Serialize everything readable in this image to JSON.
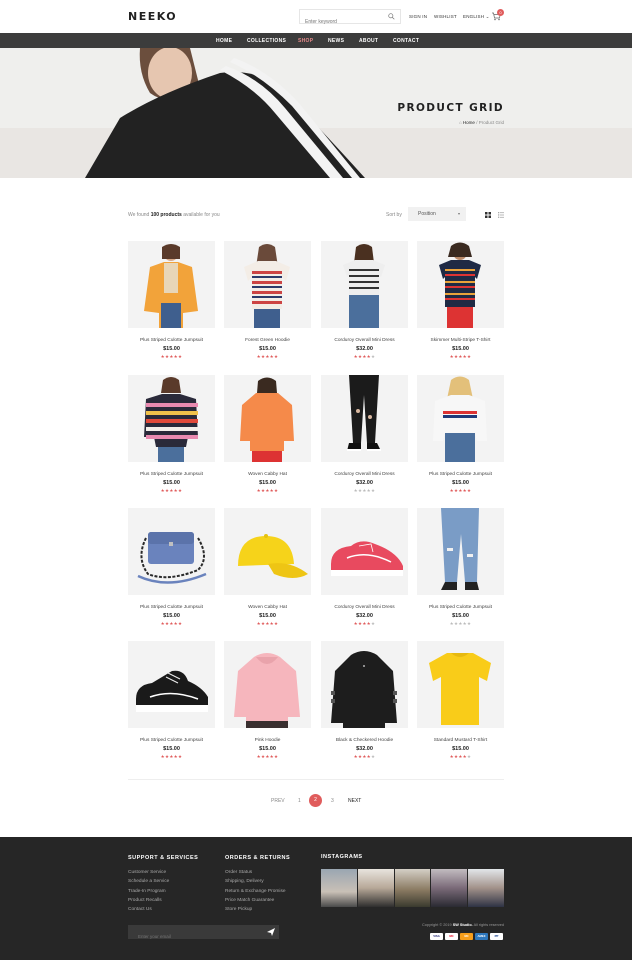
{
  "header": {
    "logo": "NEEKO",
    "search_placeholder": "Enter keyword",
    "sign_in": "SIGN IN",
    "wishlist": "WISHLIST",
    "language": "ENGLISH",
    "cart_count": "0"
  },
  "nav": {
    "items": [
      {
        "label": "HOME"
      },
      {
        "label": "COLLECTIONS"
      },
      {
        "label": "SHOP",
        "active": true
      },
      {
        "label": "NEWS"
      },
      {
        "label": "ABOUT"
      },
      {
        "label": "CONTACT"
      }
    ]
  },
  "hero": {
    "title": "PRODUCT GRID",
    "breadcrumb_home": "Home",
    "breadcrumb_sep": "/",
    "breadcrumb_current": "Product Grid"
  },
  "toolbar": {
    "found_prefix": "We found",
    "found_count": "100 products",
    "found_suffix": "available for you",
    "sort_label": "Sort by",
    "sort_value": "Position"
  },
  "products": [
    {
      "name": "Plus Striped Culotte Jumpsuit",
      "price": "$15.00",
      "rating": 5
    },
    {
      "name": "Forest Green Hoodie",
      "price": "$15.00",
      "rating": 5
    },
    {
      "name": "Corduroy Overall Mini Dress",
      "price": "$32.00",
      "rating": 4
    },
    {
      "name": "Skimmer Multi-Stripe T-Shirt",
      "price": "$15.00",
      "rating": 5
    },
    {
      "name": "Plus Striped Culotte Jumpsuit",
      "price": "$15.00",
      "rating": 5
    },
    {
      "name": "Woven Cabby Hat",
      "price": "$15.00",
      "rating": 5
    },
    {
      "name": "Corduroy Overall Mini Dress",
      "price": "$32.00",
      "rating": 0
    },
    {
      "name": "Plus Striped Culotte Jumpsuit",
      "price": "$15.00",
      "rating": 5
    },
    {
      "name": "Plus Striped Culotte Jumpsuit",
      "price": "$15.00",
      "rating": 5
    },
    {
      "name": "Woven Cabby Hat",
      "price": "$15.00",
      "rating": 5
    },
    {
      "name": "Corduroy Overall Mini Dress",
      "price": "$32.00",
      "rating": 4
    },
    {
      "name": "Plus Striped Culotte Jumpsuit",
      "price": "$15.00",
      "rating": 0
    },
    {
      "name": "Plus Striped Culotte Jumpsuit",
      "price": "$15.00",
      "rating": 5
    },
    {
      "name": "Pink Hoodie",
      "price": "$15.00",
      "rating": 5
    },
    {
      "name": "Black & Checkered Hoodie",
      "price": "$32.00",
      "rating": 4
    },
    {
      "name": "Standard Mustard T-Shirt",
      "price": "$15.00",
      "rating": 4
    }
  ],
  "pagination": {
    "prev": "PREV",
    "pages": [
      "1",
      "2",
      "3"
    ],
    "current": "2",
    "next": "NEXT"
  },
  "footer": {
    "support_title": "SUPPORT & SERVICES",
    "support_links": [
      "Customer Service",
      "Schedule a Service",
      "Trade-In Program",
      "Product Recalls",
      "Contact Us"
    ],
    "orders_title": "ORDERS & RETURNS",
    "orders_links": [
      "Order Status",
      "Shipping, Delivery",
      "Return & Exchange Promise",
      "Price Match Guarantee",
      "Store Pickup"
    ],
    "instagram_title": "INSTAGRAMS",
    "email_placeholder": "Enter your email",
    "copyright_prefix": "Copyright © 2019",
    "copyright_brand": "SW Studio.",
    "copyright_suffix": "All rights reserved",
    "payments": [
      "VISA",
      "MC",
      "MC",
      "AMEX",
      "PP"
    ]
  },
  "colors": {
    "accent": "#e05c5c",
    "nav_bg": "#3c3c3c",
    "footer_bg": "#262626"
  }
}
